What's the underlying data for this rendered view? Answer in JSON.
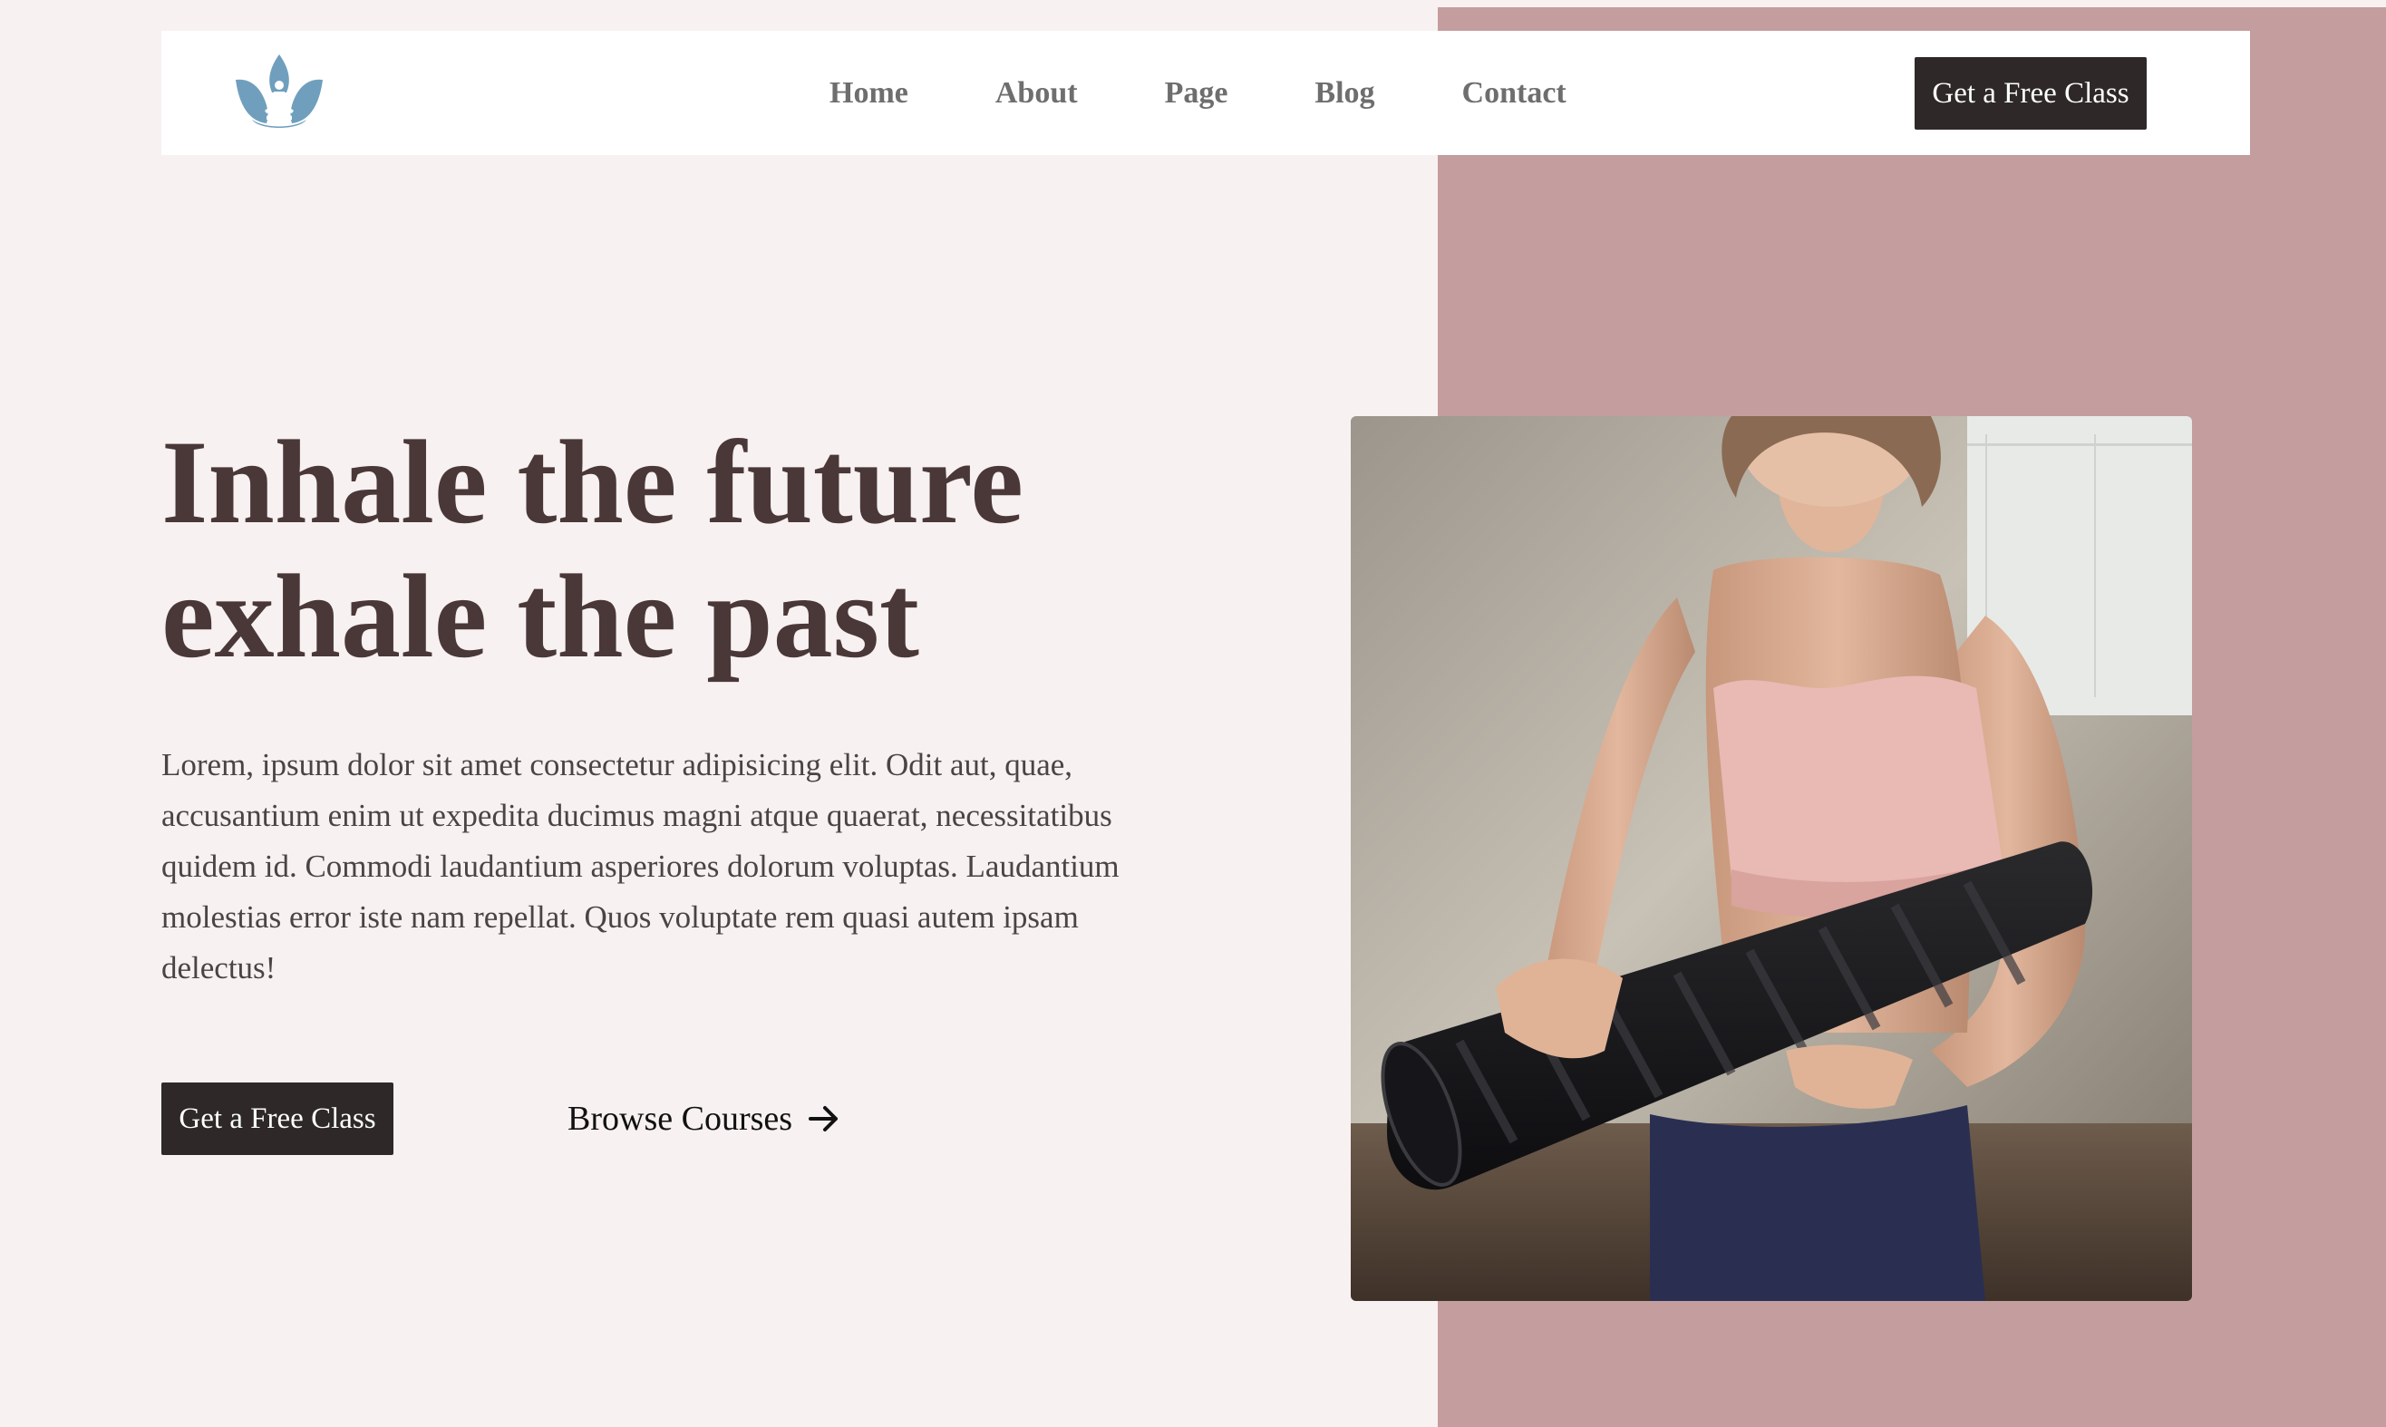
{
  "brand": {
    "logo_icon": "lotus-meditation-icon",
    "logo_color": "#6f9fbd"
  },
  "nav": {
    "items": [
      {
        "label": "Home"
      },
      {
        "label": "About"
      },
      {
        "label": "Page"
      },
      {
        "label": "Blog"
      },
      {
        "label": "Contact"
      }
    ],
    "cta_label": "Get a Free Class"
  },
  "hero": {
    "title_line1": "Inhale the future",
    "title_line2": "exhale the past",
    "body": "Lorem, ipsum dolor sit amet consectetur adipisicing elit. Odit aut, quae, accusantium enim ut expedita ducimus magni atque quaerat, necessitatibus quidem id. Commodi laudantium asperiores dolorum voluptas. Laudantium molestias error iste nam repellat. Quos voluptate rem quasi autem ipsam delectus!",
    "primary_cta": "Get a Free Class",
    "secondary_cta": "Browse Courses",
    "secondary_cta_icon": "arrow-right-icon",
    "image_icon": "woman-holding-yoga-mat-photo"
  },
  "colors": {
    "page_background": "#f8f1f1",
    "accent_panel": "#c49d9e",
    "title": "#4a3839",
    "button": "#2e2828",
    "nav_text": "#6e6e6e"
  }
}
